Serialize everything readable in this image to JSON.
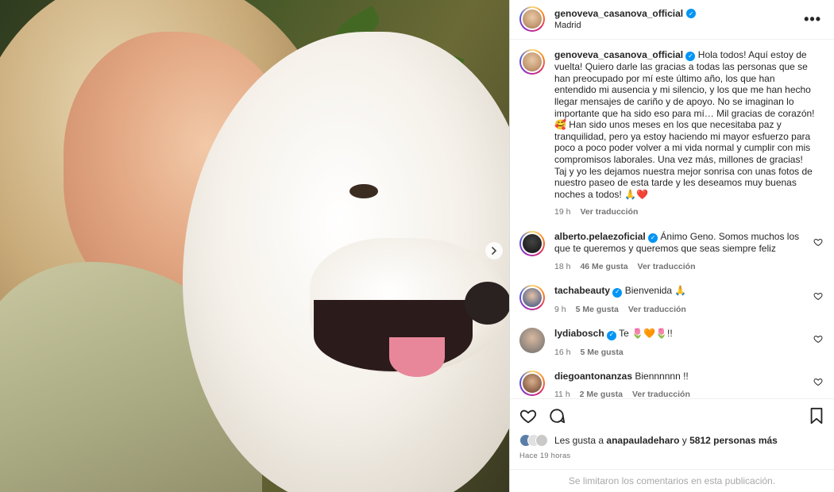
{
  "post": {
    "author": "genoveva_casanova_official",
    "location": "Madrid",
    "caption": "Hola todos! Aquí estoy de vuelta! Quiero darle las gracias a todas las personas que se han preocupado por mí este último año, los que han entendido mi ausencia y mi silencio, y los que me han hecho llegar mensajes de cariño y de apoyo. No se imaginan lo importante que ha sido eso para mí… Mil gracias de corazón! 🥰 Han sido unos meses en los que necesitaba paz y tranquilidad, pero ya estoy haciendo mi mayor esfuerzo para poco a poco poder volver a mi vida normal y cumplir con mis compromisos laborales. Una vez más, millones de gracias! Taj y yo les dejamos nuestra mejor sonrisa con unas fotos de nuestro paseo de esta tarde y les deseamos muy buenas noches a todos! 🙏❤️",
    "caption_time": "19 h",
    "see_translation": "Ver traducción"
  },
  "comments": [
    {
      "user": "alberto.pelaezoficial",
      "text": "Ánimo Geno. Somos muchos los que te queremos y queremos que seas siempre feliz",
      "time": "18 h",
      "likes": "46 Me gusta",
      "translate": "Ver traducción"
    },
    {
      "user": "tachabeauty",
      "text": "Bienvenida 🙏",
      "time": "9 h",
      "likes": "5 Me gusta",
      "translate": "Ver traducción"
    },
    {
      "user": "lydiabosch",
      "text": "Te 🌷🧡🌷!!",
      "time": "16 h",
      "likes": "5 Me gusta",
      "translate": ""
    },
    {
      "user": "diegoantonanzas",
      "text": "Biennnnnn !!",
      "time": "11 h",
      "likes": "2 Me gusta",
      "translate": "Ver traducción"
    }
  ],
  "likes_summary": {
    "prefix": "Les gusta a",
    "user": "anapauladeharo",
    "conj": "y",
    "others": "5812 personas más"
  },
  "time_ago": "Hace 19 horas",
  "footer_note": "Se limitaron los comentarios en esta publicación.",
  "icons": {
    "like": "heart-icon",
    "comment": "comment-icon",
    "save": "bookmark-icon",
    "more": "more-icon",
    "verified": "verified-badge-icon",
    "next": "chevron-right-icon"
  },
  "colors": {
    "verified": "#0095f6",
    "heart": "#ff3040",
    "muted": "#737373"
  }
}
